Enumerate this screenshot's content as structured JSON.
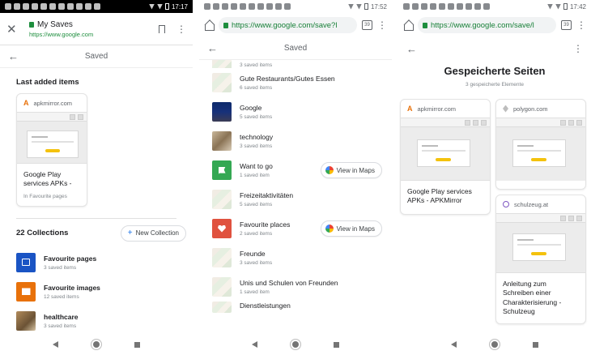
{
  "panel1": {
    "status_time": "17:17",
    "topbar": {
      "close_label": "✕",
      "title": "My Saves",
      "url": "https://www.google.com"
    },
    "saved_header": "Saved",
    "last_added_heading": "Last added items",
    "last_added_card": {
      "domain": "apkmirror.com",
      "title": "Google Play services APKs -",
      "subtitle": "In Favourite pages"
    },
    "collections_heading": "22 Collections",
    "new_collection_button": "New Collection",
    "collections": [
      {
        "name": "Favourite pages",
        "count": "3 saved items"
      },
      {
        "name": "Favourite images",
        "count": "12 saved items"
      },
      {
        "name": "healthcare",
        "count": "3 saved items"
      }
    ]
  },
  "panel2": {
    "status_time": "17:52",
    "url": "https://www.google.com/save?l",
    "tab_count": "39",
    "saved_header": "Saved",
    "partial_top_count": "3 saved items",
    "view_in_maps": "View in Maps",
    "items": [
      {
        "name": "Gute Restaurants/Gutes Essen",
        "count": "6 saved items",
        "thumb": "map"
      },
      {
        "name": "Google",
        "count": "5 saved items",
        "thumb": "photo-g"
      },
      {
        "name": "technology",
        "count": "3 saved items",
        "thumb": "photo-t"
      },
      {
        "name": "Want to go",
        "count": "1 saved item",
        "thumb": "green"
      },
      {
        "name": "Freizeitaktivitäten",
        "count": "5 saved items",
        "thumb": "map"
      },
      {
        "name": "Favourite places",
        "count": "2 saved items",
        "thumb": "red"
      },
      {
        "name": "Freunde",
        "count": "3 saved items",
        "thumb": "map"
      },
      {
        "name": "Unis und Schulen von Freunden",
        "count": "1 saved item",
        "thumb": "map"
      },
      {
        "name": "Dienstleistungen",
        "count": "",
        "thumb": "map"
      }
    ]
  },
  "panel3": {
    "status_time": "17:42",
    "url": "https://www.google.com/save/l",
    "tab_count": "39",
    "page_title": "Gespeicherte Seiten",
    "page_subtitle": "3 gespeicherte Elemente",
    "cards": [
      {
        "domain": "apkmirror.com",
        "title": "Google Play services APKs - APKMirror"
      },
      {
        "domain": "polygon.com",
        "title": ""
      },
      {
        "domain": "schulzeug.at",
        "title": "Anleitung zum Schreiben einer Charakterisierung - Schulzeug"
      }
    ]
  },
  "colors": {
    "accent_green": "#1e8e3e",
    "link_blue": "#1a73e8",
    "favorite_red": "#e0523f",
    "want_green": "#34a853"
  }
}
